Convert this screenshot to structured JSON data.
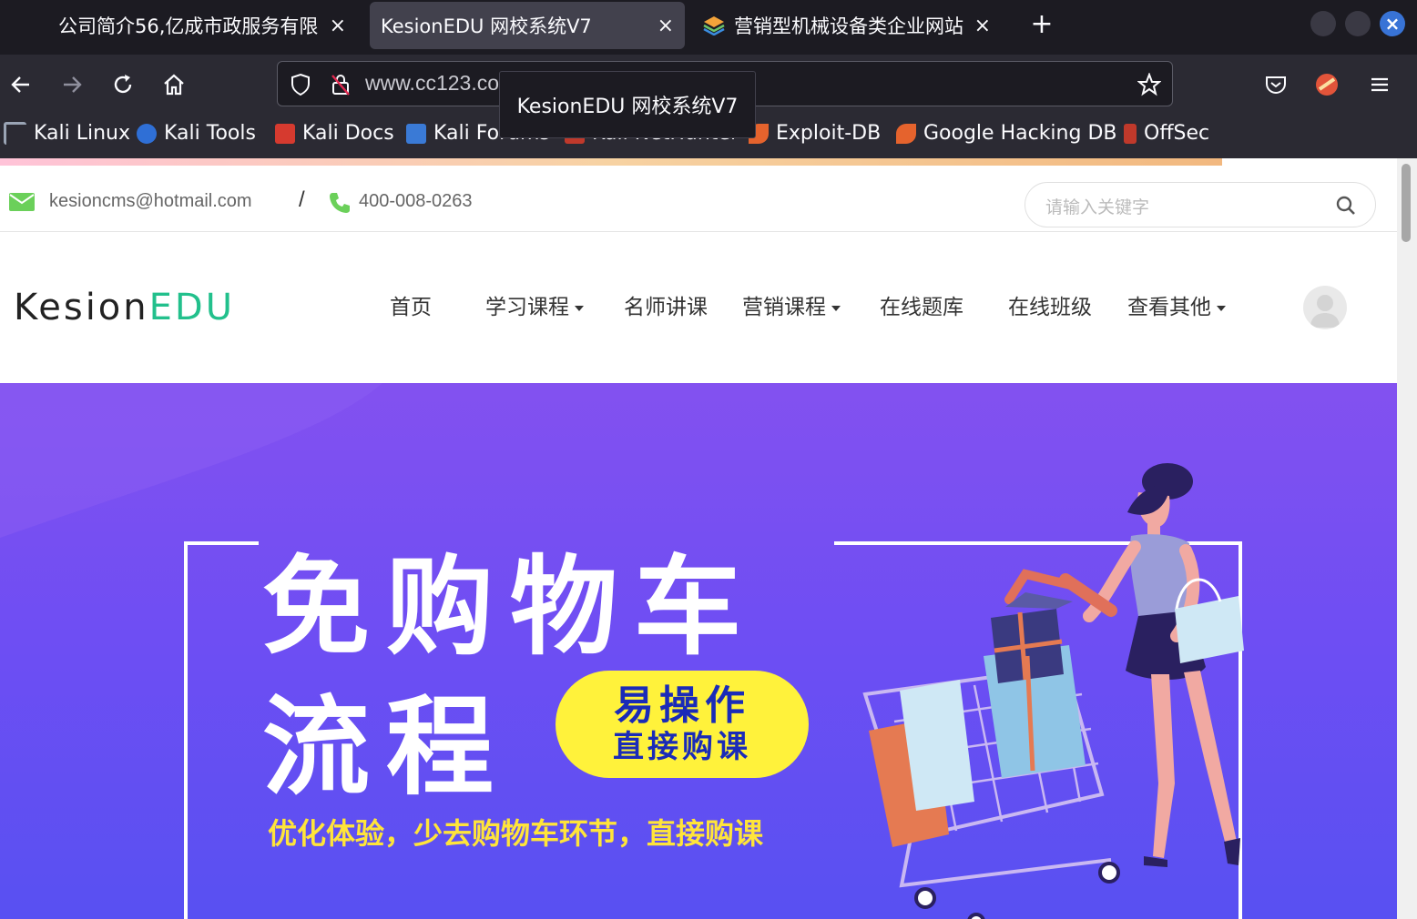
{
  "browser": {
    "tabs": [
      {
        "title": "公司简介56,亿成市政服务有限",
        "close": "×"
      },
      {
        "title": "KesionEDU 网校系统V7",
        "close": "×"
      },
      {
        "title": "营销型机械设备类企业网站",
        "close": "×"
      }
    ],
    "new_tab": "+",
    "window_close": "×",
    "url": "www.cc123.com",
    "tooltip": "KesionEDU 网校系统V7",
    "bookmarks": [
      {
        "label": "Kali Linux",
        "color": "#3b4a5c"
      },
      {
        "label": "Kali Tools",
        "color": "#2f6fd6"
      },
      {
        "label": "Kali Docs",
        "color": "#d63a2f"
      },
      {
        "label": "Kali Forums",
        "color": "#3a7ad6"
      },
      {
        "label": "Kali NetHunter",
        "color": "#c0392b"
      },
      {
        "label": "Exploit-DB",
        "color": "#e5632d"
      },
      {
        "label": "Google Hacking DB",
        "color": "#e5632d"
      },
      {
        "label": "OffSec",
        "color": "#c0392b"
      }
    ]
  },
  "site": {
    "email": "kesioncms@hotmail.com",
    "separator": "/",
    "phone": "400-008-0263",
    "search_placeholder": "请输入关键字",
    "logo_main": "Kesion",
    "logo_accent": "EDU",
    "menu": [
      {
        "label": "首页",
        "dropdown": false
      },
      {
        "label": "学习课程",
        "dropdown": true
      },
      {
        "label": "名师讲课",
        "dropdown": false
      },
      {
        "label": "营销课程",
        "dropdown": true
      },
      {
        "label": "在线题库",
        "dropdown": false
      },
      {
        "label": "在线班级",
        "dropdown": false
      },
      {
        "label": "查看其他",
        "dropdown": true
      }
    ],
    "banner": {
      "line1": "免购物车",
      "line2": "流程",
      "pill_line1": "易操作",
      "pill_line2": "直接购课",
      "slogan": "优化体验，少去购物车环节，直接购课"
    }
  },
  "colors": {
    "brand_green": "#22c08c",
    "banner_purple": "#6f4ef3",
    "pill_yellow": "#fff23b",
    "slogan_yellow": "#ffe43a"
  }
}
